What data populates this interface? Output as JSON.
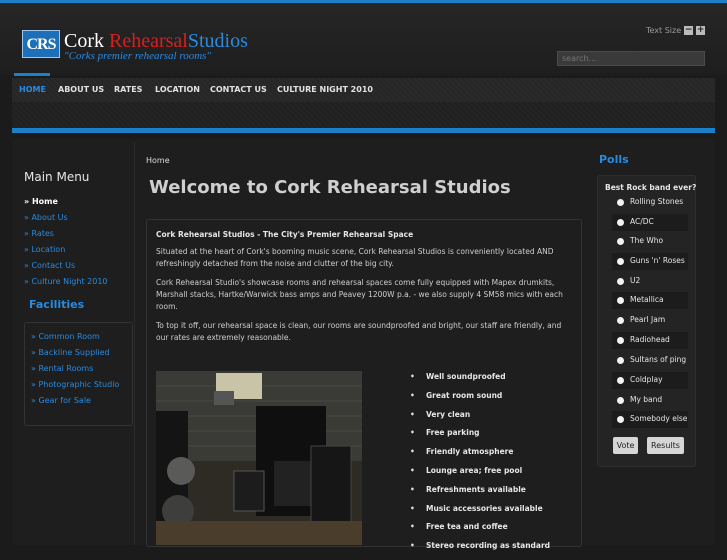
{
  "logo": {
    "initials": "CRS",
    "word1": "Cork",
    "word2": "Rehearsal",
    "word3": "Studios",
    "tagline": "\"Corks premier rehearsal rooms\""
  },
  "header": {
    "text_size_label": "Text Size",
    "text_size_decrease": "−",
    "text_size_increase": "+",
    "search_placeholder": "search..."
  },
  "nav": [
    {
      "label": "HOME",
      "active": true
    },
    {
      "label": "ABOUT US"
    },
    {
      "label": "RATES"
    },
    {
      "label": "LOCATION"
    },
    {
      "label": "CONTACT US"
    },
    {
      "label": "CULTURE NIGHT 2010"
    }
  ],
  "main_menu": {
    "title": "Main Menu",
    "items": [
      "Home",
      "About Us",
      "Rates",
      "Location",
      "Contact Us",
      "Culture Night 2010"
    ]
  },
  "facilities": {
    "title": "Facilities",
    "items": [
      "Common Room",
      "Backline Supplied",
      "Rental Rooms",
      "Photographic Studio",
      "Gear for Sale"
    ]
  },
  "breadcrumb": "Home",
  "article": {
    "title": "Welcome to Cork Rehearsal Studios",
    "heading": "Cork Rehearsal Studios - The City's Premier Rehearsal Space",
    "p1": "Situated at the heart of Cork's booming music scene, Cork Rehearsal Studios is conveniently located AND refreshingly detached from the noise and clutter of the big city.",
    "p2": "Cork Rehearsal Studio's showcase rooms and rehearsal spaces come fully equipped with Mapex drumkits, Marshall stacks, Hartke/Warwick bass amps and Peavey 1200W p.a. - we also supply 4 SM58 mics with each room.",
    "p3": "To top it off, our rehearsal space is clean, our rooms are soundproofed and bright, our staff are friendly, and our rates are extremely reasonable.",
    "features": [
      "Well soundproofed",
      "Great room sound",
      "Very clean",
      "Free parking",
      "Friendly atmosphere",
      "Lounge area; free pool",
      "Refreshments available",
      "Music accessories available",
      "Free tea and coffee",
      "Stereo recording as standard"
    ]
  },
  "polls": {
    "title": "Polls",
    "question": "Best Rock band ever?",
    "options": [
      "Rolling Stones",
      "AC/DC",
      "The Who",
      "Guns 'n' Roses",
      "U2",
      "Metallica",
      "Pearl Jam",
      "Radiohead",
      "Sultans of ping",
      "Coldplay",
      "My band",
      "Somebody else"
    ],
    "vote_label": "Vote",
    "results_label": "Results"
  }
}
